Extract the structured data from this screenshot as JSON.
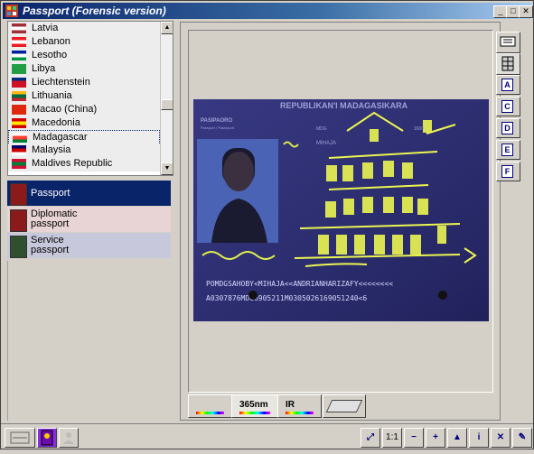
{
  "window": {
    "title": "Passport (Forensic version)",
    "controls": {
      "minimize": "_",
      "maximize": "□",
      "close": "✕"
    }
  },
  "countries": [
    {
      "name": "Latvia",
      "flag": [
        "#9e3039",
        "#ffffff",
        "#9e3039"
      ]
    },
    {
      "name": "Lebanon",
      "flag": [
        "#ed1c24",
        "#ffffff",
        "#ed1c24"
      ]
    },
    {
      "name": "Lesotho",
      "flag": [
        "#00209f",
        "#ffffff",
        "#009543"
      ]
    },
    {
      "name": "Libya",
      "flag": [
        "#239e46",
        "#239e46",
        "#239e46"
      ]
    },
    {
      "name": "Liechtenstein",
      "flag": [
        "#002b7f",
        "#ce1126",
        "#ce1126"
      ]
    },
    {
      "name": "Lithuania",
      "flag": [
        "#fdb913",
        "#006a44",
        "#c1272d"
      ]
    },
    {
      "name": "Macao (China)",
      "flag": [
        "#de2910",
        "#de2910",
        "#de2910"
      ]
    },
    {
      "name": "Macedonia",
      "flag": [
        "#d20000",
        "#ffe600",
        "#d20000"
      ]
    },
    {
      "name": "Madagascar",
      "flag": [
        "#ffffff",
        "#fc3d32",
        "#007e3a"
      ]
    },
    {
      "name": "Malaysia",
      "flag": [
        "#010066",
        "#cc0001",
        "#ffffff"
      ]
    },
    {
      "name": "Maldives Republic",
      "flag": [
        "#d21034",
        "#007e3a",
        "#d21034"
      ]
    }
  ],
  "selected_country": "Madagascar",
  "document_types": [
    {
      "label": "Passport",
      "selected": true,
      "color": "#0a246a",
      "icon_color": "#8b1a1a"
    },
    {
      "label": "Diplomatic passport",
      "selected": false,
      "color": "#e8d4d4",
      "icon_color": "#8b1a1a"
    },
    {
      "label": "Service passport",
      "selected": false,
      "color": "#c8c8dc",
      "icon_color": "#2f4f2f"
    }
  ],
  "side_tabs": [
    "A",
    "C",
    "D",
    "E",
    "F"
  ],
  "bottom_tabs": [
    {
      "label": "",
      "icon": "palette-icon"
    },
    {
      "label": "365nm",
      "icon": "uv-icon"
    },
    {
      "label": "IR",
      "icon": "ir-icon"
    },
    {
      "label": "",
      "icon": "stack-icon"
    }
  ],
  "passport": {
    "header": "REPUBLIKAN'I MADAGASIKARA",
    "type_label": "PASIPAORO",
    "type_label_en": "Passport / Passeport",
    "code": "MDG",
    "surname": "MIHAJA",
    "mrz_line1": "POMDGSAHOBY<MIHAJA<<ANDRIANHARIZAFY<<<<<<<<",
    "mrz_line2": "A0307876MDG6905211M0305026169051240<6",
    "number_small": "1600"
  },
  "statusbar_tools": [
    "fit-icon",
    "1:1",
    "zoom-out-icon",
    "zoom-in-icon",
    "stamp-icon",
    "info-icon",
    "tools-icon",
    "brush-icon"
  ]
}
